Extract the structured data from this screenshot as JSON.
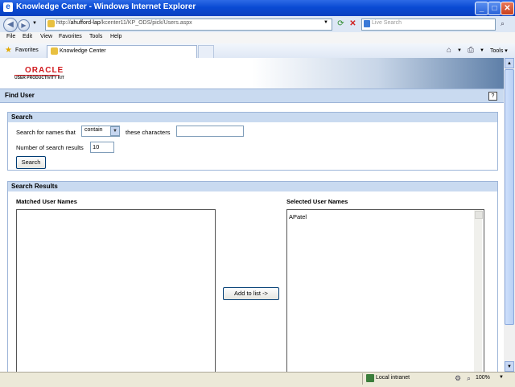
{
  "window": {
    "title": "Knowledge Center - Windows Internet Explorer",
    "min": "_",
    "max": "□",
    "close": "✕"
  },
  "addressbar": {
    "url_prefix": "http://",
    "url_host": "ahufford-lap",
    "url_path": "/kcenter11/KP_ODS/pick/Users.aspx",
    "search_placeholder": "Live Search"
  },
  "menu": [
    "File",
    "Edit",
    "View",
    "Favorites",
    "Tools",
    "Help"
  ],
  "favorites": {
    "label": "Favorites",
    "tab_label": "Knowledge Center",
    "tools_label": "Tools"
  },
  "branding": {
    "logo": "ORACLE",
    "subtitle": "USER PRODUCTIVITY KIT"
  },
  "page": {
    "title": "Find User",
    "help": "?"
  },
  "search_panel": {
    "title": "Search",
    "names_label": "Search for names that",
    "match_value": "contain",
    "chars_label": "these characters",
    "chars_value": "",
    "results_label": "Number of search results",
    "results_value": "10",
    "button": "Search"
  },
  "results_panel": {
    "title": "Search Results",
    "matched_label": "Matched User Names",
    "selected_label": "Selected User Names",
    "matched_items": [],
    "selected_items": [
      "APatel"
    ],
    "add_button": "Add to list ->"
  },
  "statusbar": {
    "zone": "Local intranet",
    "zoom": "100%"
  },
  "icons": {
    "title": "ie-icon",
    "back": "back-arrow-icon",
    "forward": "forward-arrow-icon",
    "refresh": "refresh-icon",
    "stop": "stop-icon",
    "search": "search-icon",
    "favorites": "star-icon",
    "home": "home-icon",
    "print": "printer-icon",
    "help": "help-icon",
    "zone": "intranet-zone-icon"
  },
  "colors": {
    "titlebar": "#0a4bd4",
    "panel_header": "#c9daf0",
    "oracle_red": "#d0191e"
  }
}
